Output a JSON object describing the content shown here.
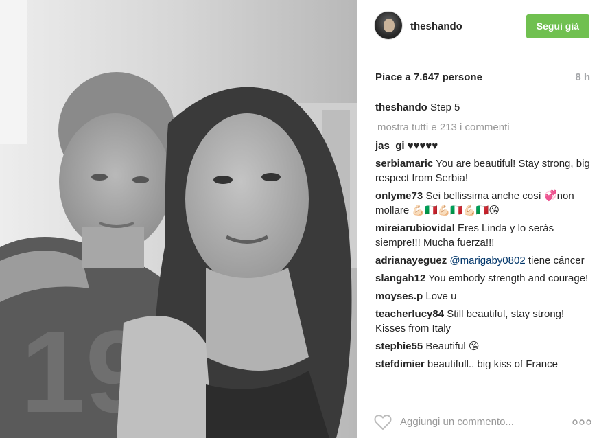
{
  "post": {
    "author": "theshando",
    "follow_label": "Segui già",
    "likes_text": "Piace a 7.647 persone",
    "time_ago": "8 h",
    "caption": "Step 5",
    "view_all": "mostra tutti e 213 i commenti"
  },
  "comments": [
    {
      "user": "jas_gi",
      "text": "♥♥♥♥♥"
    },
    {
      "user": "serbiamaric",
      "text": "You are beautiful! Stay strong, big respect from Serbia!"
    },
    {
      "user": "onlyme73",
      "text": "Sei bellissima anche così 💞non mollare 💪🏻🇮🇹💪🏻🇮🇹💪🏻🇮🇹😘"
    },
    {
      "user": "mireiarubiovidal",
      "text": "Eres Linda y lo seràs siempre!!! Mucha fuerza!!!"
    },
    {
      "user": "adrianayeguez",
      "mention": "@marigaby0802",
      "text": "tiene cáncer"
    },
    {
      "user": "slangah12",
      "text": "You embody strength and courage!"
    },
    {
      "user": "moyses.p",
      "text": "Love u"
    },
    {
      "user": "teacherlucy84",
      "text": "Still beautiful, stay strong! Kisses from Italy"
    },
    {
      "user": "stephie55",
      "text": "Beautiful 😘"
    },
    {
      "user": "stefdimier",
      "text": "beautifull.. big kiss of France"
    }
  ],
  "footer": {
    "comment_placeholder": "Aggiungi un commento...",
    "like_icon": "heart-outline-icon",
    "options_icon": "more-options-icon"
  },
  "colors": {
    "follow_button": "#70c050",
    "mention": "#003569",
    "muted": "#999999"
  }
}
